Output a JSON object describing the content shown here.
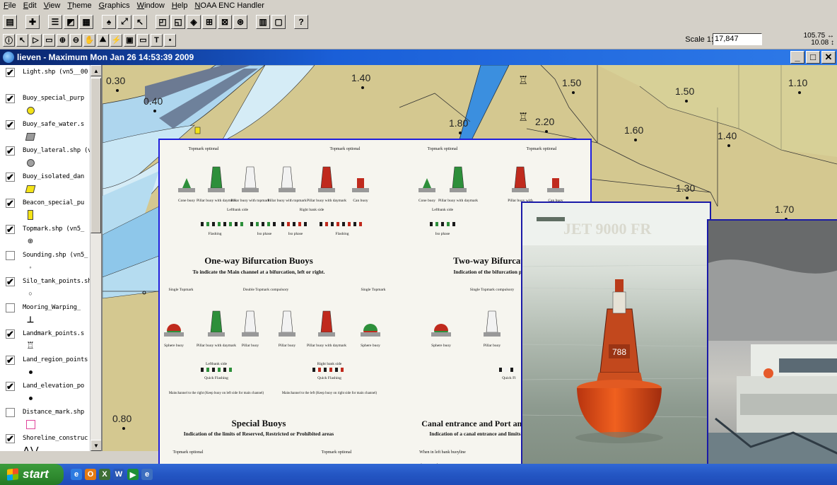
{
  "menubar": [
    "File",
    "Edit",
    "View",
    "Theme",
    "Graphics",
    "Window",
    "Help",
    "NOAA ENC Handler"
  ],
  "toolbar": {
    "scale_label": "Scale 1:",
    "scale_value": "17,847",
    "coord_x": "105.75",
    "coord_y": "10.08"
  },
  "window": {
    "title": "lieven - Maximum Mon Jan 26 14:53:39 2009"
  },
  "toc": {
    "layers": [
      {
        "name": "Light.shp (vn5__00",
        "checked": true,
        "symbol": "none"
      },
      {
        "name": "Buoy_special_purp",
        "checked": true,
        "symbol": "yellow-circle"
      },
      {
        "name": "Buoy_safe_water.s",
        "checked": true,
        "symbol": "gray-square"
      },
      {
        "name": "Buoy_lateral.shp (v",
        "checked": true,
        "symbol": "gray-circle"
      },
      {
        "name": "Buoy_isolated_dan",
        "checked": true,
        "symbol": "yellow-parallelogram"
      },
      {
        "name": "Beacon_special_pu",
        "checked": true,
        "symbol": "yellow-rect"
      },
      {
        "name": "Topmark.shp (vn5_",
        "checked": true,
        "symbol": "crosshair"
      },
      {
        "name": "Sounding.shp (vn5_",
        "checked": false,
        "symbol": "dot"
      },
      {
        "name": "Silo_tank_points.sh",
        "checked": true,
        "symbol": "small-circle"
      },
      {
        "name": "Mooring_Warping_",
        "checked": false,
        "symbol": "anchor"
      },
      {
        "name": "Landmark_points.s",
        "checked": true,
        "symbol": "landmark"
      },
      {
        "name": "Land_region_points",
        "checked": true,
        "symbol": "black-dot"
      },
      {
        "name": "Land_elevation_po",
        "checked": true,
        "symbol": "black-dot"
      },
      {
        "name": "Distance_mark.shp",
        "checked": false,
        "symbol": "pink-marker"
      },
      {
        "name": "Shoreline_construc",
        "checked": true,
        "symbol": "zigzag"
      }
    ]
  },
  "map": {
    "soundings": [
      "0.30",
      "0.40",
      "1.40",
      "1.50",
      "1.50",
      "1.10",
      "1.80",
      "2.20",
      "1.60",
      "1.40",
      "1.30",
      "1.70",
      "0.80"
    ]
  },
  "poster": {
    "topmark_optional": "Topmark optional",
    "labels_top_left": [
      "Cone buoy",
      "Pillar buoy with daymark",
      "Pillar buoy with topmark",
      "Pillar buoy with topmark",
      "Pillar buoy with daymark",
      "Can buoy"
    ],
    "labels_top_right": [
      "Cone buoy",
      "Pillar buoy with daymark",
      "Pillar buoy with",
      "Can buoy"
    ],
    "left_bank": "Leftbank side",
    "right_bank": "Right bank side",
    "flashing": "Flashing",
    "iso_phase": "Iso phase",
    "oneway_title": "One-way Bifurcation Buoys",
    "oneway_sub": "To indicate the Main channel at a bifurcation, left or right.",
    "twoway_title": "Two-way Bifurcatio",
    "twoway_sub": "Indication of the bifurcation point",
    "single_topmark": "Single Topmark",
    "double_topmark": "Double Topmark compulsory",
    "single_topmark_compulsory": "Single Topmark compulsory",
    "bif_labels": [
      "Sphere buoy",
      "Pillar buoy with daymark",
      "Pillar buoy",
      "Pillar buoy",
      "Pillar buoy with daymark",
      "Sphere buoy"
    ],
    "bif_right_labels": [
      "Sphere buoy",
      "Pillar buoy"
    ],
    "leftbank_side": "Leftbank side",
    "rightbank_side": "Right bank side",
    "quick_flashing": "Quick Flashing",
    "quick_fl_right": "Quick Fl",
    "main_right": "Mainchannel to the right (Keep buoy on left side for main channel)",
    "main_left": "Mainchannel to the left (Keep buoy on right side for main channel)",
    "special_title": "Special Buoys",
    "special_sub": "Indication of the limits of Reserved, Restricted or Prohibited areas",
    "canal_title": "Canal entrance and Port and T",
    "canal_sub": "Indication of a canal entrance and limits of",
    "when_left": "When in left bank buoyline"
  },
  "photo1": {
    "watermark": "JET 9000 FR",
    "buoy_number": "788"
  },
  "taskbar": {
    "start": "start"
  }
}
